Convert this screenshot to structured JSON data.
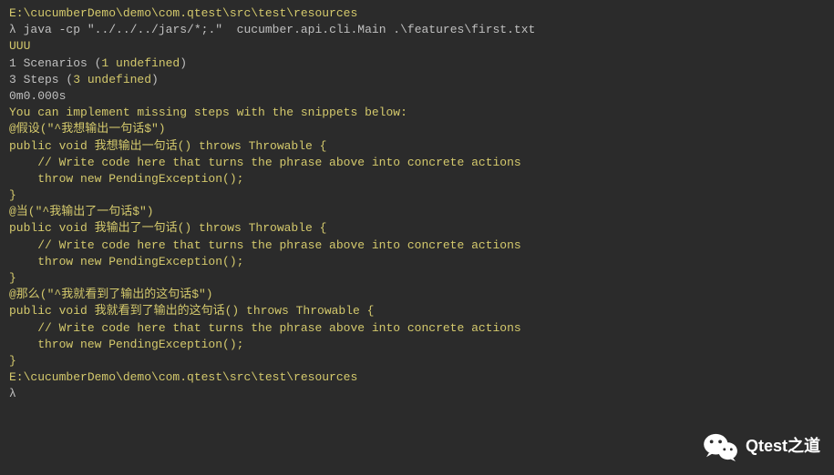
{
  "terminal": {
    "path1": "E:\\cucumberDemo\\demo\\com.qtest\\src\\test\\resources",
    "prompt": "λ",
    "command": "java -cp \"../../../jars/*;.\"  cucumber.api.cli.Main .\\features\\first.txt",
    "output_uuu": "UUU",
    "blank1": "",
    "scenarios_prefix": "1 Scenarios (",
    "scenarios_yellow": "1 undefined",
    "scenarios_suffix": ")",
    "steps_prefix": "3 Steps (",
    "steps_yellow": "3 undefined",
    "steps_suffix": ")",
    "time": "0m0.000s",
    "blank2": "",
    "blank3": "",
    "implement_msg": "You can implement missing steps with the snippets below:",
    "blank4": "",
    "snippet1_l1": "@假设(\"^我想输出一句话$\")",
    "snippet1_l2": "public void 我想输出一句话() throws Throwable {",
    "snippet1_l3": "    // Write code here that turns the phrase above into concrete actions",
    "snippet1_l4": "    throw new PendingException();",
    "snippet1_l5": "}",
    "blank5": "",
    "snippet2_l1": "@当(\"^我输出了一句话$\")",
    "snippet2_l2": "public void 我输出了一句话() throws Throwable {",
    "snippet2_l3": "    // Write code here that turns the phrase above into concrete actions",
    "snippet2_l4": "    throw new PendingException();",
    "snippet2_l5": "}",
    "blank6": "",
    "snippet3_l1": "@那么(\"^我就看到了输出的这句话$\")",
    "snippet3_l2": "public void 我就看到了输出的这句话() throws Throwable {",
    "snippet3_l3": "    // Write code here that turns the phrase above into concrete actions",
    "snippet3_l4": "    throw new PendingException();",
    "snippet3_l5": "}",
    "blank7": "",
    "path2": "E:\\cucumberDemo\\demo\\com.qtest\\src\\test\\resources",
    "prompt2": "λ"
  },
  "watermark": {
    "text": "Qtest之道"
  }
}
